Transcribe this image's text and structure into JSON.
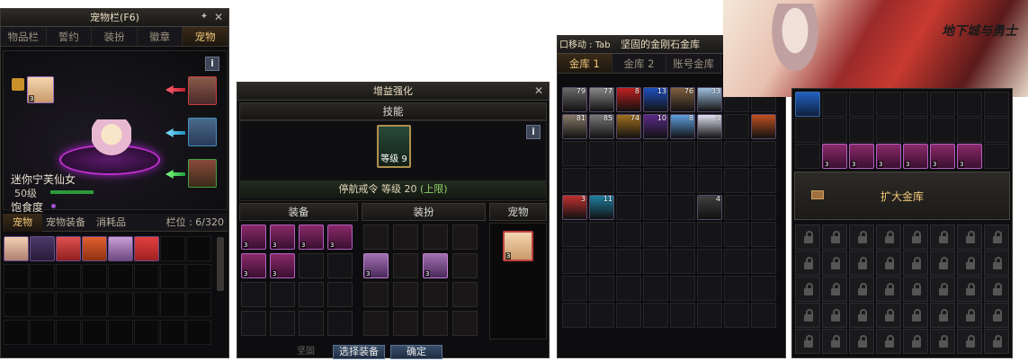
{
  "pet_window": {
    "title": "宠物栏(F6)",
    "tabs": [
      "物品栏",
      "誓约",
      "装扮",
      "徽章",
      "宠物"
    ],
    "active_tab": "宠物",
    "info_label": "i",
    "pet_name": "迷你宁芙仙女",
    "pet_level": "50级",
    "satiety_label": "饱食度",
    "sub_tabs": [
      "宠物",
      "宠物装备",
      "消耗品"
    ],
    "active_sub_tab": "宠物",
    "slot_count": "栏位 : 6/320"
  },
  "buff_window": {
    "title": "增益强化",
    "skill_header": "技能",
    "skill_level": "等级 9",
    "info_label": "i",
    "skill_desc": "停航戒令 等级 20",
    "skill_limit": "(上限)",
    "equip_header": "装备",
    "avatar_header": "装扮",
    "creature_header": "宠物",
    "select_equip_button": "选择装备",
    "confirm_button": "确定",
    "bottom_hint": "坚固"
  },
  "storage_window": {
    "move_hint": "口移动 : Tab",
    "title": "坚固的金刚石金库",
    "tabs": [
      "金库 1",
      "金库 2",
      "账号金库"
    ],
    "active_tab": "金库 1",
    "row1_counts": [
      "79",
      "77",
      "8",
      "13",
      "76",
      "33",
      "",
      ""
    ],
    "row2_counts": [
      "81",
      "85",
      "74",
      "10",
      "8",
      "5",
      "",
      ""
    ],
    "row5_counts": [
      "3",
      "11",
      "",
      "",
      "",
      "4",
      "",
      ""
    ]
  },
  "expand_window": {
    "expand_button": "扩大金库"
  },
  "banner": {
    "logo_text": "地下城与勇士"
  },
  "colors": {
    "accent": "#f2c878",
    "panel_bg": "#0d0d0f",
    "button_blue": "#2a3c56",
    "green_text": "#8fd06a"
  }
}
